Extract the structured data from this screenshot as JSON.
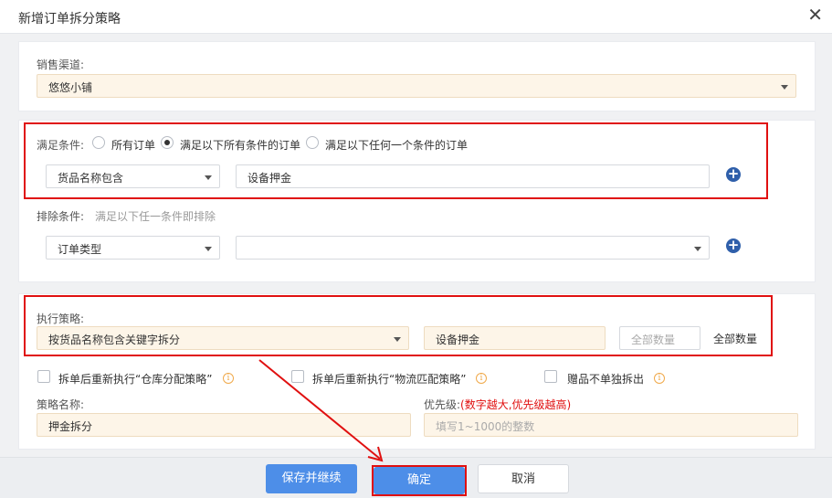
{
  "dialog": {
    "title": "新增订单拆分策略"
  },
  "channel": {
    "label": "销售渠道:",
    "value": "悠悠小铺"
  },
  "conditions": {
    "label": "满足条件:",
    "options": [
      "所有订单",
      "满足以下所有条件的订单",
      "满足以下任何一个条件的订单"
    ],
    "selected_index": 1,
    "field": "货品名称包含",
    "value": "设备押金"
  },
  "exclusion": {
    "label": "排除条件:",
    "hint": "满足以下任一条件即排除",
    "field": "订单类型",
    "value": ""
  },
  "strategy": {
    "label": "执行策略:",
    "value": "按货品名称包含关键字拆分",
    "keyword": "设备押金",
    "quantity_placeholder": "全部数量",
    "quantity_button": "全部数量"
  },
  "options": {
    "rerun_warehouse": "拆单后重新执行“仓库分配策略”",
    "rerun_logistics": "拆单后重新执行“物流匹配策略”",
    "gift_no_split": "赠品不单独拆出"
  },
  "policy_name": {
    "label": "策略名称:",
    "value": "押金拆分"
  },
  "priority": {
    "label": "优先级:",
    "note": "(数字越大,优先级越高)",
    "placeholder": "填写1~1000的整数"
  },
  "footer": {
    "save_continue": "保存并继续",
    "confirm": "确定",
    "cancel": "取消"
  },
  "colors": {
    "primary": "#4d8ee8",
    "annotation_red": "#e01010",
    "accent_blue": "#2f5faa",
    "warm_field": "#fdf5e8"
  }
}
